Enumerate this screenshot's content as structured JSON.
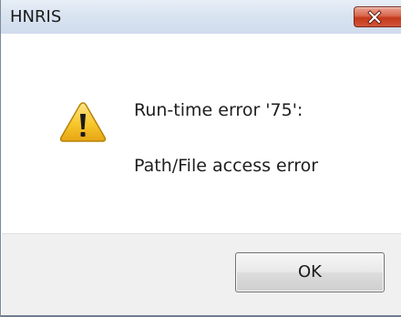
{
  "window": {
    "title": "HNRIS",
    "close_icon": "close-icon"
  },
  "message": {
    "icon": "warning-icon",
    "line1": "Run-time error '75':",
    "line2": "Path/File access error"
  },
  "buttons": {
    "ok_label": "OK"
  },
  "colors": {
    "titlebar": "#d9e4f1",
    "close_button": "#c5391b",
    "footer": "#f0f0f0",
    "warning_fill": "#f7c72b"
  }
}
